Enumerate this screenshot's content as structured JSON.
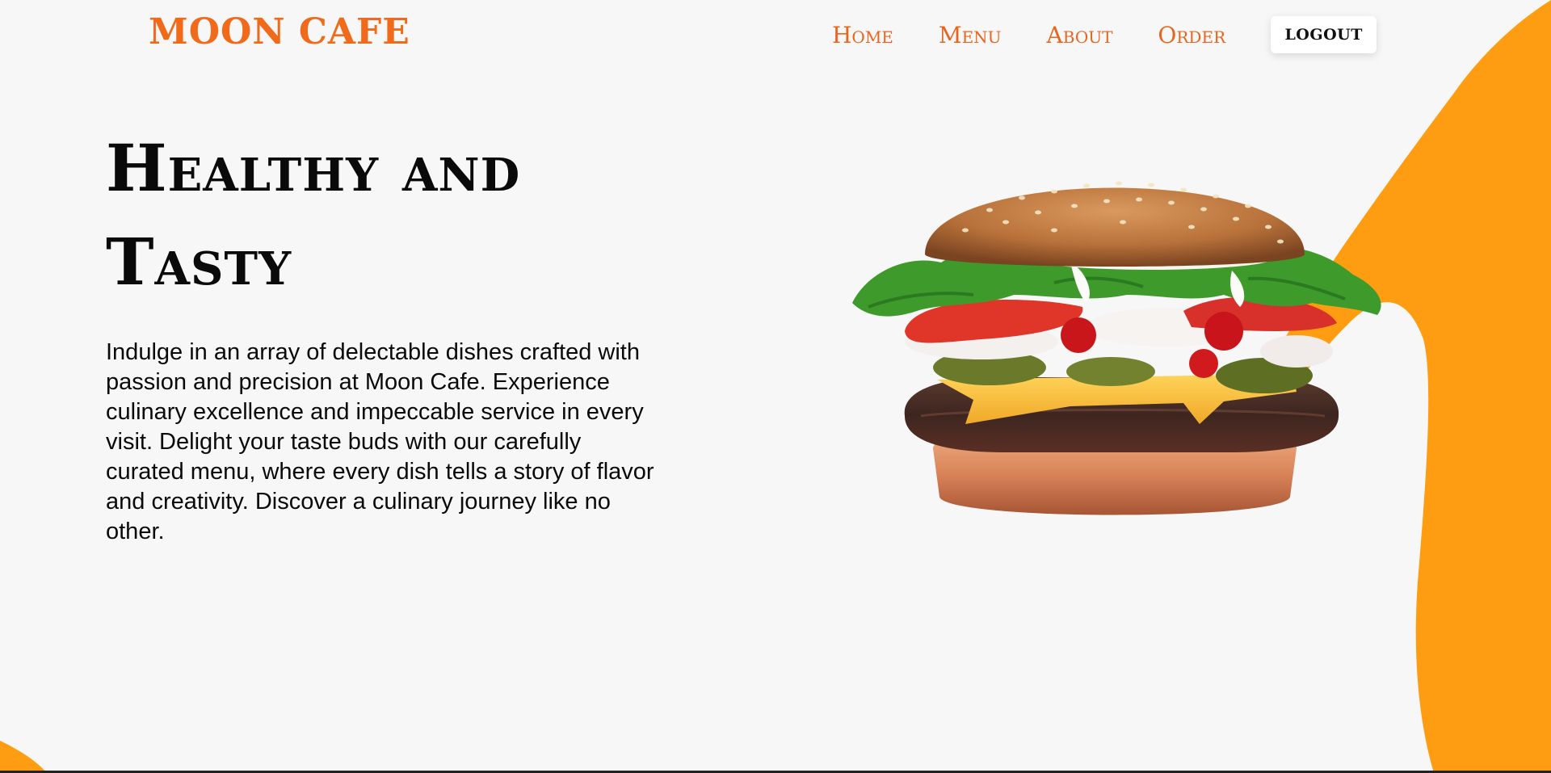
{
  "header": {
    "logo": "MOON CAFE",
    "nav": [
      {
        "label": "Home"
      },
      {
        "label": "Menu"
      },
      {
        "label": "About"
      },
      {
        "label": "Order"
      }
    ],
    "logout_label": "LOGOUT"
  },
  "hero": {
    "title": "Healthy and Tasty",
    "description": "Indulge in an array of delectable dishes crafted with passion and precision at Moon Cafe. Experience culinary excellence and impeccable service in every visit. Delight your taste buds with our carefully curated menu, where every dish tells a story of flavor and creativity. Discover a culinary journey like no other.",
    "image_name": "burger-image"
  },
  "colors": {
    "brand_orange": "#f06a1a",
    "accent_blob": "#ff9d12",
    "background": "#f7f7f7",
    "text": "#0a0a0a"
  }
}
